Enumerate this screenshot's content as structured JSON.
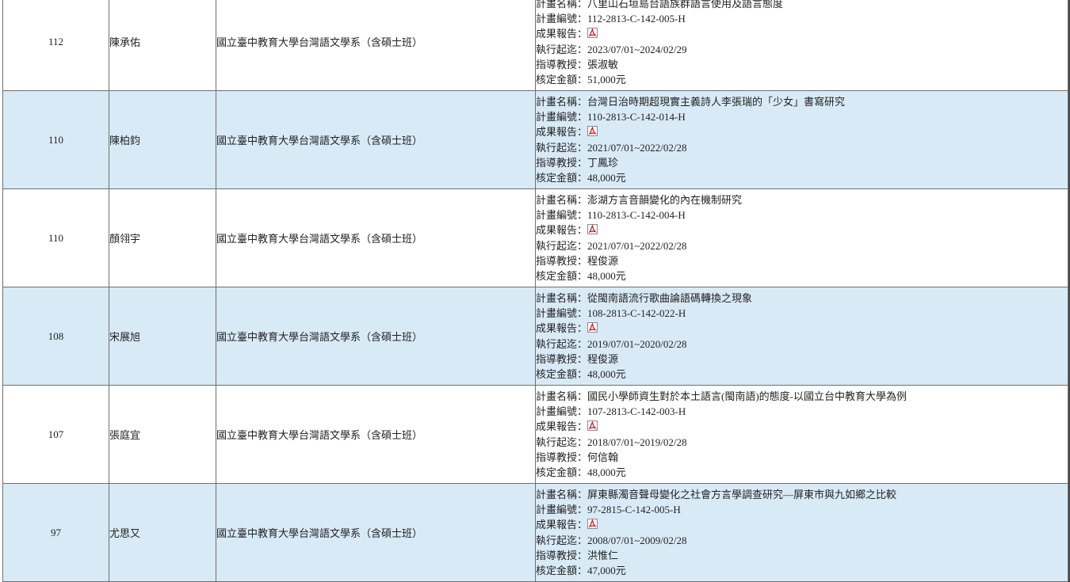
{
  "labels": {
    "plan_name": "計畫名稱：",
    "plan_id": "計畫編號：",
    "report": "成果報告：",
    "period": "執行起迄：",
    "advisor": "指導教授：",
    "amount": "核定金額："
  },
  "colors": {
    "alt_row": "#d9eaf7",
    "border": "#6f6f6f"
  },
  "rows": [
    {
      "year": "112",
      "student": "陳承佑",
      "dept": "國立臺中教育大學台灣語文學系（含碩士班）",
      "plan_name": "八里山石垣島台語族群語言使用及語言態度",
      "plan_id": "112-2813-C-142-005-H",
      "report_icon": "pdf-icon",
      "period": "2023/07/01~2024/02/29",
      "advisor": "張淑敏",
      "amount": "51,000元"
    },
    {
      "year": "110",
      "student": "陳柏鈞",
      "dept": "國立臺中教育大學台灣語文學系（含碩士班）",
      "plan_name": "台灣日治時期超現實主義詩人李張瑞的「少女」書寫研究",
      "plan_id": "110-2813-C-142-014-H",
      "report_icon": "pdf-icon",
      "period": "2021/07/01~2022/02/28",
      "advisor": "丁鳳珍",
      "amount": "48,000元"
    },
    {
      "year": "110",
      "student": "顏翎宇",
      "dept": "國立臺中教育大學台灣語文學系（含碩士班）",
      "plan_name": "澎湖方言音韻變化的內在機制研究",
      "plan_id": "110-2813-C-142-004-H",
      "report_icon": "pdf-icon",
      "period": "2021/07/01~2022/02/28",
      "advisor": "程俊源",
      "amount": "48,000元"
    },
    {
      "year": "108",
      "student": "宋展旭",
      "dept": "國立臺中教育大學台灣語文學系（含碩士班）",
      "plan_name": "從閩南語流行歌曲論語碼轉換之現象",
      "plan_id": "108-2813-C-142-022-H",
      "report_icon": "pdf-icon",
      "period": "2019/07/01~2020/02/28",
      "advisor": "程俊源",
      "amount": "48,000元"
    },
    {
      "year": "107",
      "student": "張庭宜",
      "dept": "國立臺中教育大學台灣語文學系（含碩士班）",
      "plan_name": "國民小學師資生對於本土語言(閩南語)的態度-以國立台中教育大學為例",
      "plan_id": "107-2813-C-142-003-H",
      "report_icon": "pdf-icon",
      "period": "2018/07/01~2019/02/28",
      "advisor": "何信翰",
      "amount": "48,000元"
    },
    {
      "year": "97",
      "student": "尤思又",
      "dept": "國立臺中教育大學台灣語文學系（含碩士班）",
      "plan_name": "屏東縣濁音聲母變化之社會方言學調查研究—屏東市與九如鄉之比較",
      "plan_id": "97-2815-C-142-005-H",
      "report_icon": "pdf-icon",
      "period": "2008/07/01~2009/02/28",
      "advisor": "洪惟仁",
      "amount": "47,000元"
    }
  ]
}
